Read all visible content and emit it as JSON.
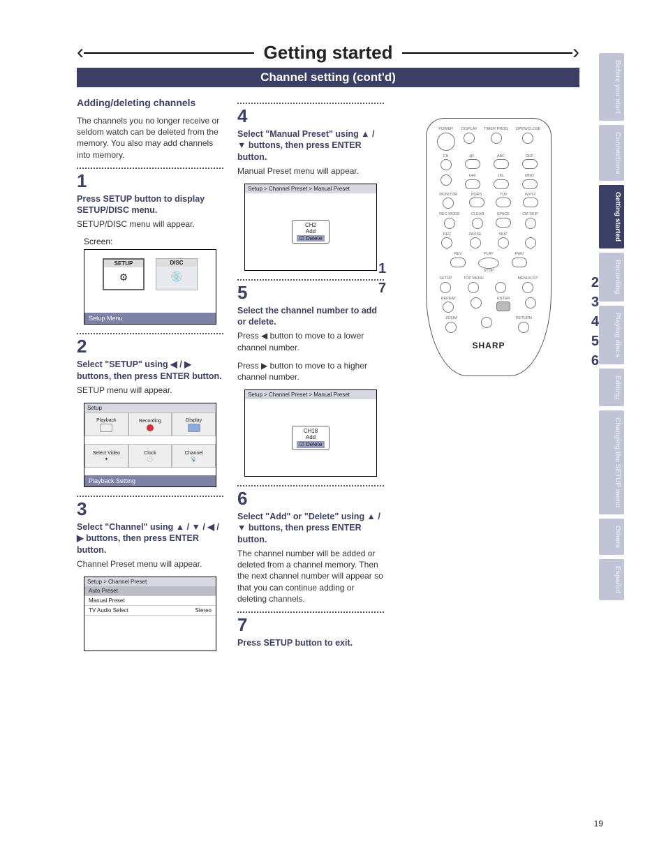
{
  "header": {
    "title": "Getting started",
    "subtitle": "Channel setting (cont'd)"
  },
  "col1": {
    "heading": "Adding/deleting channels",
    "intro": "The channels you no longer receive or seldom watch can be deleted from the memory. You also may add channels into memory.",
    "step1": {
      "num": "1",
      "title": "Press SETUP button to display SETUP/DISC menu.",
      "text": "SETUP/DISC menu will appear.",
      "caption": "Screen:",
      "mock": {
        "tile1": "SETUP",
        "tile2": "DISC",
        "footer": "Setup Menu"
      }
    },
    "step2": {
      "num": "2",
      "title": "Select \"SETUP\" using ◀ / ▶ buttons, then press ENTER button.",
      "text": "SETUP menu will appear.",
      "mock": {
        "shead": "Setup",
        "cells": [
          "Playback",
          "Recording",
          "Display",
          "Select Video",
          "Clock",
          "Channel"
        ],
        "footer": "Playback Setting"
      }
    },
    "step3": {
      "num": "3",
      "title": "Select \"Channel\" using ▲ / ▼ / ◀ / ▶ buttons, then press ENTER button.",
      "text": "Channel Preset menu will appear.",
      "mock": {
        "shead": "Setup > Channel Preset",
        "rows": [
          {
            "l": "Auto Preset",
            "r": ""
          },
          {
            "l": "Manual Preset",
            "r": ""
          },
          {
            "l": "TV Audio Select",
            "r": "Stereo"
          }
        ]
      }
    }
  },
  "col2": {
    "step4": {
      "num": "4",
      "title": "Select \"Manual Preset\" using ▲ / ▼ buttons, then press ENTER button.",
      "text": "Manual Preset menu will appear.",
      "mock": {
        "shead": "Setup > Channel Preset > Manual Preset",
        "ch": "CH2",
        "add": "Add",
        "del": "Delete"
      }
    },
    "step5": {
      "num": "5",
      "title": "Select the channel number to add or delete.",
      "text1": "Press ◀ button to move to a lower channel number.",
      "text2": "Press ▶ button to move to a higher channel number.",
      "mock": {
        "shead": "Setup > Channel Preset > Manual Preset",
        "ch": "CH18",
        "add": "Add",
        "del": "Delete"
      }
    },
    "step6": {
      "num": "6",
      "title": "Select \"Add\" or \"Delete\" using ▲ / ▼ buttons, then press ENTER button.",
      "text": "The channel number will be added or deleted from a channel memory. Then the next channel number will appear so that you can continue adding or deleting channels."
    },
    "step7": {
      "num": "7",
      "title": "Press SETUP button to exit."
    }
  },
  "remote": {
    "toprow": [
      "POWER",
      "DISPLAY",
      "TIMER PROG.",
      "OPEN/CLOSE"
    ],
    "numlabels": [
      "@!.",
      "ABC",
      "DEF",
      "GHI",
      "JKL",
      "MNO",
      "PQRS",
      "TUV",
      "WXYZ",
      "SPACE"
    ],
    "ch": "CH",
    "monitor": "MONITOR",
    "recmode": "REC MODE",
    "clear": "CLEAR",
    "cmskip": "CM SKIP",
    "rec": "REC",
    "pause": "PAUSE",
    "skip": "SKIP",
    "play": "PLAY",
    "rev": "REV",
    "stop": "STOP",
    "fwd": "FWD",
    "setup": "SETUP",
    "topmenu": "TOP MENU",
    "menulist": "MENU/LIST",
    "repeat": "REPEAT",
    "enter": "ENTER",
    "zoom": "ZOOM",
    "return": "RETURN",
    "brand": "SHARP"
  },
  "callouts": {
    "left": [
      "1",
      "7"
    ],
    "right": [
      "2",
      "3",
      "4",
      "5",
      "6"
    ]
  },
  "sidetabs": [
    {
      "label": "Before you start",
      "active": false
    },
    {
      "label": "Connections",
      "active": false
    },
    {
      "label": "Getting started",
      "active": true
    },
    {
      "label": "Recording",
      "active": false
    },
    {
      "label": "Playing discs",
      "active": false
    },
    {
      "label": "Editing",
      "active": false
    },
    {
      "label": "Changing the SETUP menu",
      "active": false
    },
    {
      "label": "Others",
      "active": false
    },
    {
      "label": "Español",
      "active": false
    }
  ],
  "pagenum": "19"
}
